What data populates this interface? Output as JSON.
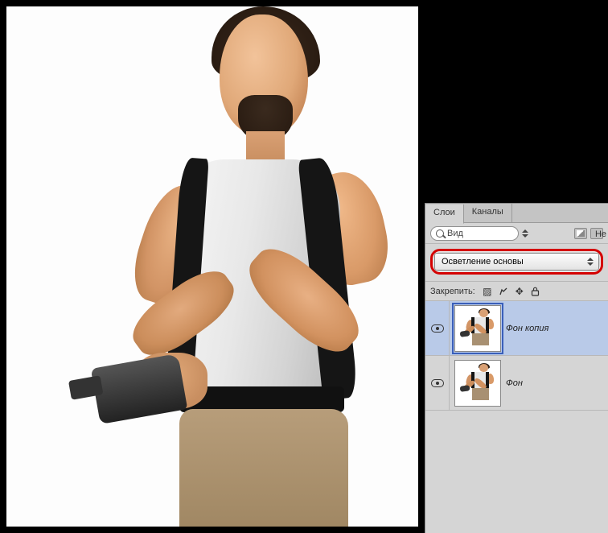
{
  "panel": {
    "tabs": {
      "layers": "Слои",
      "channels": "Каналы"
    },
    "filter": {
      "kind_label": "Вид"
    },
    "blend_mode": "Осветление основы",
    "lock_label": "Закрепить:",
    "truncated_side": "Не"
  },
  "layers": [
    {
      "name": "Фон копия",
      "visible": true,
      "selected": true
    },
    {
      "name": "Фон",
      "visible": true,
      "selected": false
    }
  ]
}
